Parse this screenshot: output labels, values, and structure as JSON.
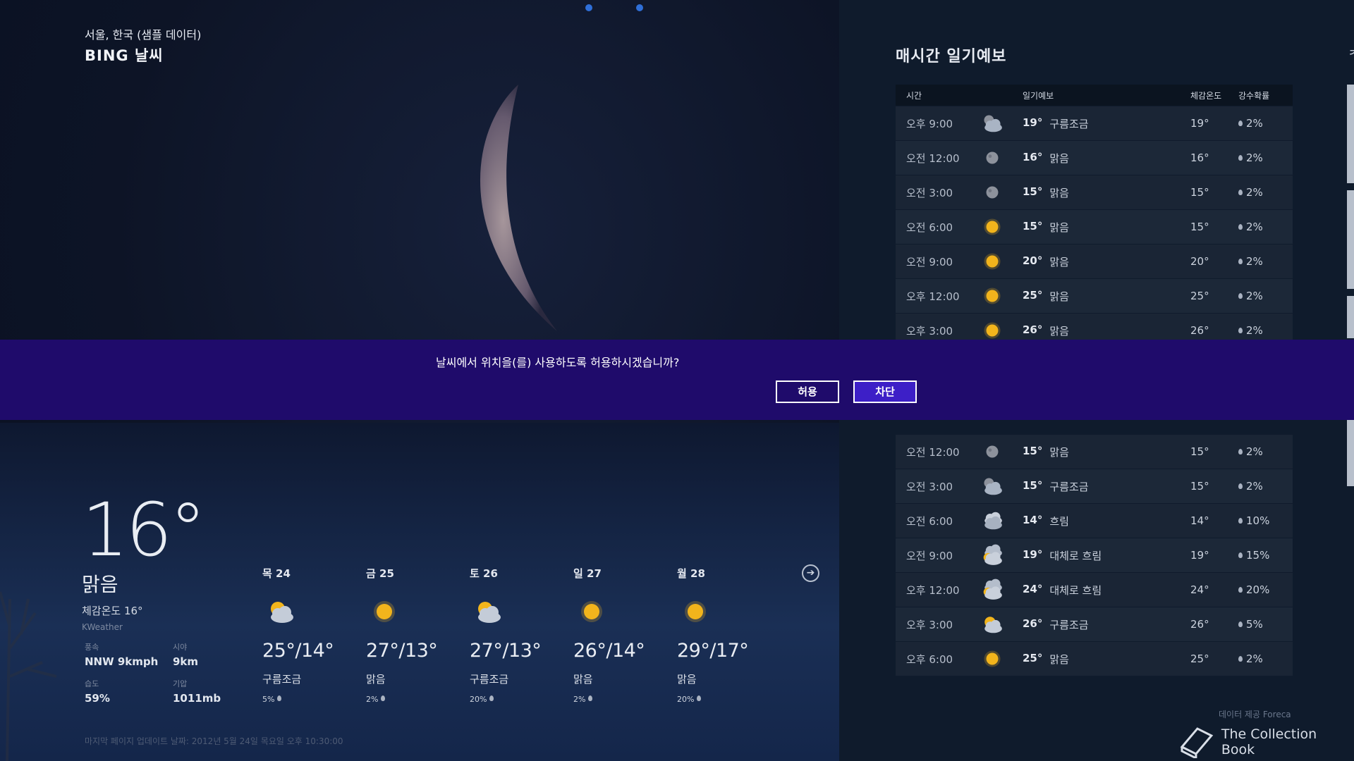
{
  "header": {
    "location": "서울, 한국 (샘플 데이터)",
    "app_title": "BING 날씨"
  },
  "current": {
    "temperature": "16°",
    "condition": "맑음",
    "feels_like": "체감온도 16°",
    "provider": "KWeather",
    "stats": [
      {
        "label": "풍속",
        "value": "NNW 9kmph"
      },
      {
        "label": "시야",
        "value": "9km"
      },
      {
        "label": "습도",
        "value": "59%"
      },
      {
        "label": "기압",
        "value": "1011mb"
      }
    ]
  },
  "daily": [
    {
      "day": "목 24",
      "icon": "partly-cloudy-icon",
      "hilo": "25°/14°",
      "condition": "구름조금",
      "pop": "5%"
    },
    {
      "day": "금 25",
      "icon": "sun-icon",
      "hilo": "27°/13°",
      "condition": "맑음",
      "pop": "2%"
    },
    {
      "day": "토 26",
      "icon": "partly-cloudy-icon",
      "hilo": "27°/13°",
      "condition": "구름조금",
      "pop": "20%"
    },
    {
      "day": "일 27",
      "icon": "sun-icon",
      "hilo": "26°/14°",
      "condition": "맑음",
      "pop": "2%"
    },
    {
      "day": "월 28",
      "icon": "sun-icon",
      "hilo": "29°/17°",
      "condition": "맑음",
      "pop": "20%"
    }
  ],
  "last_updated": "마지막 페이지 업데이트 날짜: 2012년 5월 24일 목요일 오후 10:30:00",
  "hourly": {
    "title": "매시간 일기예보",
    "columns": [
      "시간",
      "일기예보",
      "체감온도",
      "강수확률"
    ],
    "rows_top": [
      {
        "time": "오후 9:00",
        "icon": "cloudy-moon-icon",
        "temp": "19°",
        "condition": "구름조금",
        "feels": "19°",
        "pop": "2%"
      },
      {
        "time": "오전 12:00",
        "icon": "moon-icon",
        "temp": "16°",
        "condition": "맑음",
        "feels": "16°",
        "pop": "2%"
      },
      {
        "time": "오전 3:00",
        "icon": "moon-icon",
        "temp": "15°",
        "condition": "맑음",
        "feels": "15°",
        "pop": "2%"
      },
      {
        "time": "오전 6:00",
        "icon": "sun-icon",
        "temp": "15°",
        "condition": "맑음",
        "feels": "15°",
        "pop": "2%"
      },
      {
        "time": "오전 9:00",
        "icon": "sun-icon",
        "temp": "20°",
        "condition": "맑음",
        "feels": "20°",
        "pop": "2%"
      },
      {
        "time": "오후 12:00",
        "icon": "sun-icon",
        "temp": "25°",
        "condition": "맑음",
        "feels": "25°",
        "pop": "2%"
      },
      {
        "time": "오후 3:00",
        "icon": "sun-icon",
        "temp": "26°",
        "condition": "맑음",
        "feels": "26°",
        "pop": "2%"
      }
    ],
    "rows_bottom": [
      {
        "time": "오전 12:00",
        "icon": "moon-icon",
        "temp": "15°",
        "condition": "맑음",
        "feels": "15°",
        "pop": "2%"
      },
      {
        "time": "오전 3:00",
        "icon": "cloudy-moon-icon",
        "temp": "15°",
        "condition": "구름조금",
        "feels": "15°",
        "pop": "2%"
      },
      {
        "time": "오전 6:00",
        "icon": "cloud-icon",
        "temp": "14°",
        "condition": "흐림",
        "feels": "14°",
        "pop": "10%"
      },
      {
        "time": "오전 9:00",
        "icon": "mostly-cloudy-icon",
        "temp": "19°",
        "condition": "대체로 흐림",
        "feels": "19°",
        "pop": "15%"
      },
      {
        "time": "오후 12:00",
        "icon": "mostly-cloudy-icon",
        "temp": "24°",
        "condition": "대체로 흐림",
        "feels": "24°",
        "pop": "20%"
      },
      {
        "time": "오후 3:00",
        "icon": "partly-cloudy-icon",
        "temp": "26°",
        "condition": "구름조금",
        "feels": "26°",
        "pop": "5%"
      },
      {
        "time": "오후 6:00",
        "icon": "sun-icon",
        "temp": "25°",
        "condition": "맑음",
        "feels": "25°",
        "pop": "2%"
      }
    ]
  },
  "footer": {
    "data_credit": "데이터 제공 Foreca",
    "watermark": "The Collection Book"
  },
  "dialog": {
    "message": "날씨에서 위치을(를) 사용하도록 허용하시겠습니까?",
    "allow_label": "허용",
    "block_label": "차단"
  },
  "colors": {
    "dialog_bg": "#1f0b6b",
    "block_button": "#3d1fc7",
    "page_dot": "#2f6fd8"
  }
}
